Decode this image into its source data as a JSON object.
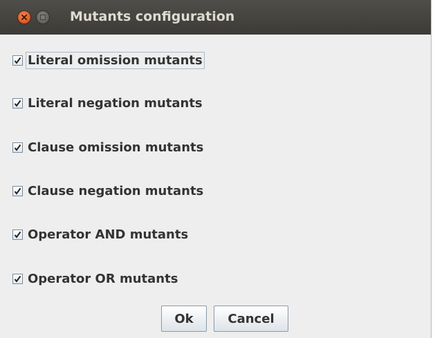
{
  "window": {
    "title": "Mutants configuration"
  },
  "options": [
    {
      "label": "Literal omission mutants",
      "checked": true
    },
    {
      "label": "Literal negation mutants",
      "checked": true
    },
    {
      "label": "Clause omission mutants",
      "checked": true
    },
    {
      "label": "Clause negation mutants",
      "checked": true
    },
    {
      "label": "Operator AND mutants",
      "checked": true
    },
    {
      "label": "Operator OR mutants",
      "checked": true
    }
  ],
  "buttons": {
    "ok": "Ok",
    "cancel": "Cancel"
  }
}
